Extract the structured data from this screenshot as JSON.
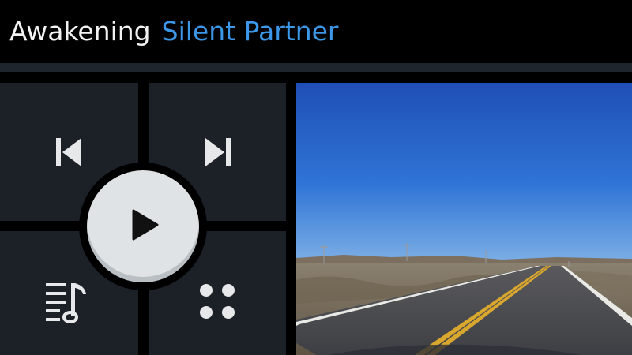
{
  "now_playing": {
    "track_title": "Awakening",
    "artist": "Silent Partner"
  },
  "controls": {
    "previous_icon": "skip-previous-icon",
    "next_icon": "skip-next-icon",
    "play_icon": "play-icon",
    "queue_icon": "music-queue-icon",
    "apps_icon": "apps-grid-icon"
  },
  "colors": {
    "artist_accent": "#3d97e8",
    "tile_background": "#1c2128",
    "play_button": "#dfe3e5"
  }
}
